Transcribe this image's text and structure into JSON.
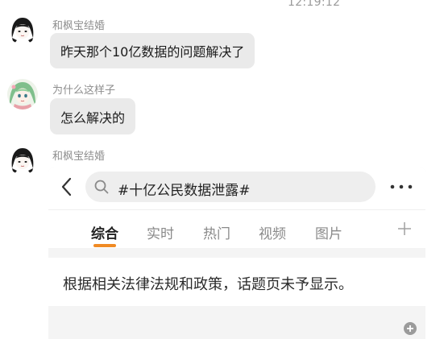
{
  "chat": {
    "timestamp": "12:19:12",
    "messages": [
      {
        "sender": "和枫宝结婚",
        "avatar_icon": "anime-girl-black-hair-avatar",
        "type": "text",
        "text": "昨天那个10亿数据的问题解决了"
      },
      {
        "sender": "为什么这样子",
        "avatar_icon": "anime-girl-green-hair-avatar",
        "type": "text",
        "text": "怎么解决的"
      },
      {
        "sender": "和枫宝结婚",
        "avatar_icon": "anime-girl-black-hair-avatar",
        "type": "image"
      }
    ]
  },
  "weibo_screenshot": {
    "search": {
      "query": "#十亿公民数据泄露#"
    },
    "tabs": [
      {
        "label": "综合",
        "active": true
      },
      {
        "label": "实时",
        "active": false
      },
      {
        "label": "热门",
        "active": false
      },
      {
        "label": "视频",
        "active": false
      },
      {
        "label": "图片",
        "active": false
      }
    ],
    "notice": "根据相关法律法规和政策，话题页未予显示。",
    "accent_color": "#f08a24"
  }
}
